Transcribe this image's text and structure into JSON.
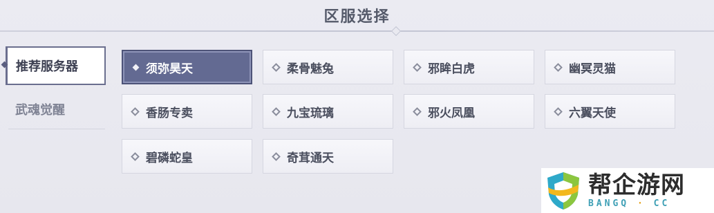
{
  "header": {
    "title": "区服选择"
  },
  "tabs": [
    {
      "label": "推荐服务器",
      "active": true
    },
    {
      "label": "武魂觉醒",
      "active": false
    }
  ],
  "servers": [
    {
      "name": "须弥昊天",
      "selected": true
    },
    {
      "name": "柔骨魅兔"
    },
    {
      "name": "邪眸白虎"
    },
    {
      "name": "幽冥灵猫"
    },
    {
      "name": "香肠专卖"
    },
    {
      "name": "九宝琉璃"
    },
    {
      "name": "邪火凤凰"
    },
    {
      "name": "六翼天使"
    },
    {
      "name": "碧磷蛇皇"
    },
    {
      "name": "奇茸通天"
    }
  ],
  "watermark": {
    "name": "帮企游网",
    "domain_left": "BANGQ",
    "domain_sep": "·",
    "domain_right": "CC"
  },
  "colors": {
    "selected_bg": "#636a92",
    "accent": "#5b5f80"
  }
}
